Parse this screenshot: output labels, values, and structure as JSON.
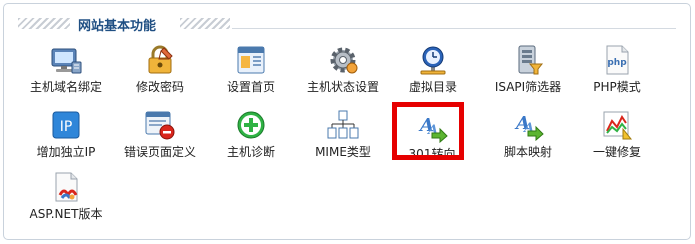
{
  "section": {
    "title": "网站基本功能"
  },
  "items": [
    {
      "label": "主机域名绑定",
      "icon": "computer-network-icon"
    },
    {
      "label": "修改密码",
      "icon": "lock-pencil-icon"
    },
    {
      "label": "设置首页",
      "icon": "webpage-settings-icon"
    },
    {
      "label": "主机状态设置",
      "icon": "gear-icon"
    },
    {
      "label": "虚拟目录",
      "icon": "globe-clock-icon"
    },
    {
      "label": "ISAPI筛选器",
      "icon": "server-filter-icon"
    },
    {
      "label": "PHP模式",
      "icon": "php-file-icon"
    },
    {
      "label": "增加独立IP",
      "icon": "ip-icon"
    },
    {
      "label": "错误页面定义",
      "icon": "error-page-icon"
    },
    {
      "label": "主机诊断",
      "icon": "green-plus-icon"
    },
    {
      "label": "MIME类型",
      "icon": "mime-network-icon"
    },
    {
      "label": "301转向",
      "icon": "redirect-arrow-icon"
    },
    {
      "label": "脚本映射",
      "icon": "script-mapping-icon"
    },
    {
      "label": "一键修复",
      "icon": "repair-chart-icon"
    },
    {
      "label": "ASP.NET版本",
      "icon": "aspnet-file-icon"
    }
  ],
  "highlighted_item": "301转向",
  "colors": {
    "title": "#1f4f83",
    "highlight": "#e60000",
    "border": "#c9d2dc"
  }
}
